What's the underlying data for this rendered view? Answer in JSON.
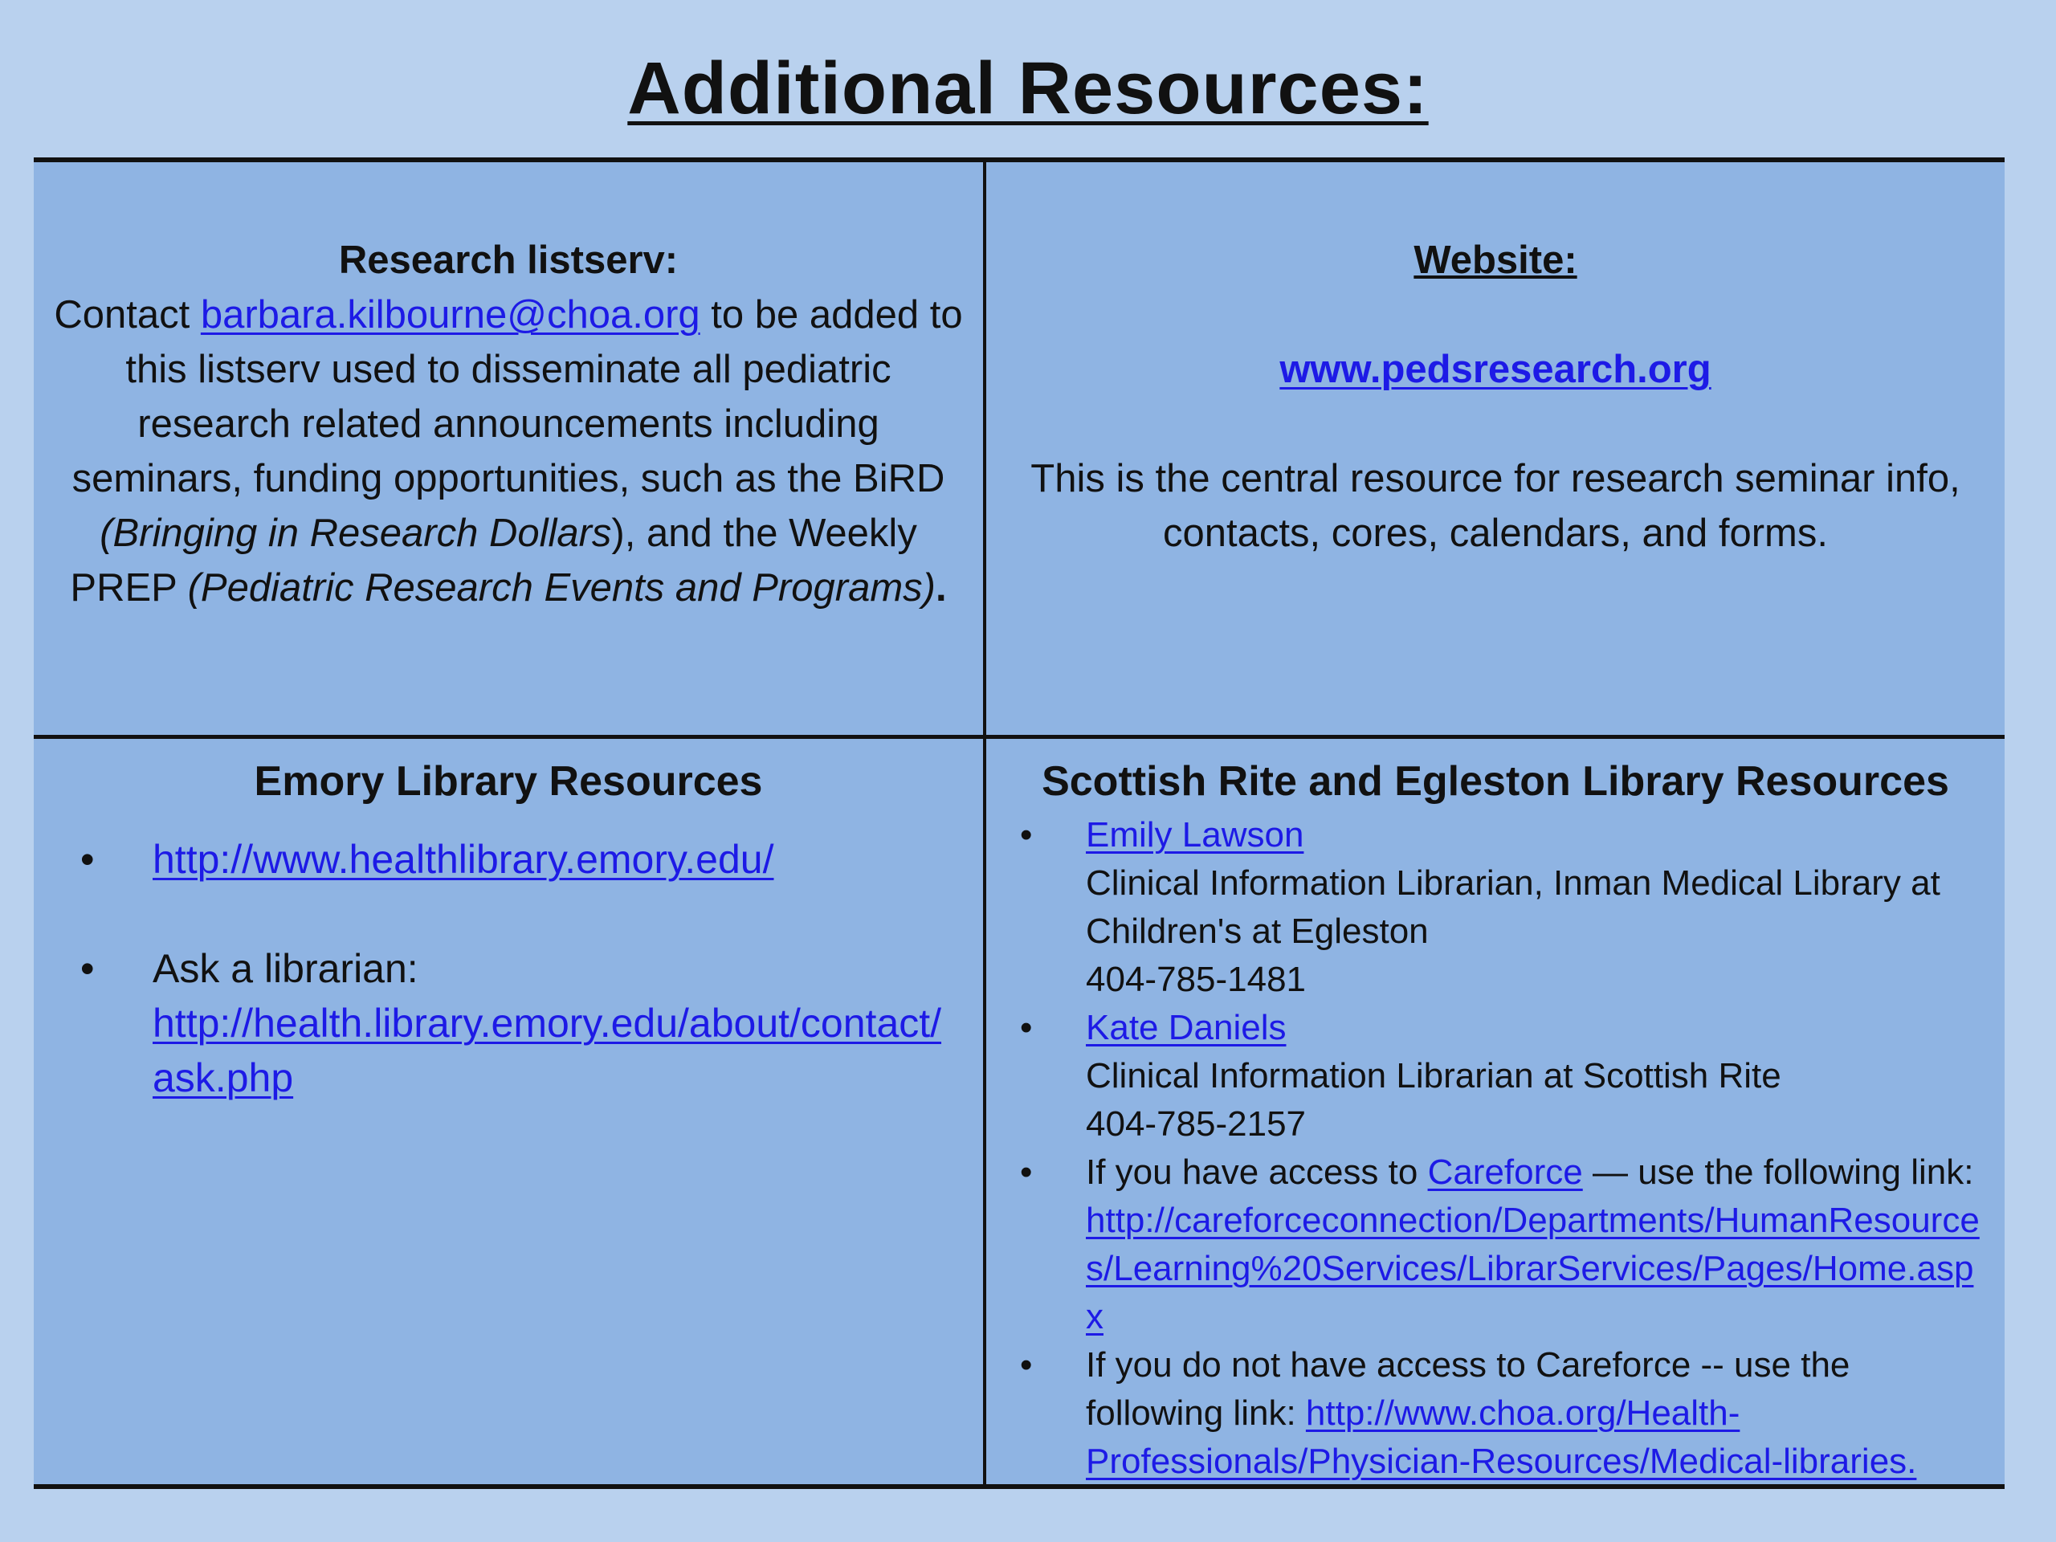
{
  "page": {
    "title": "Additional Resources:"
  },
  "listserv": {
    "heading": "Research listserv:",
    "contact_prefix": "Contact ",
    "email": "barbara.kilbourne@choa.org",
    "text_1": " to be added to this listserv used to disseminate all pediatric research related announcements including seminars, funding opportunities, such as the  BiRD ",
    "bird_full": "(Bringing in Research Dollars",
    "text_2": "), and the Weekly PREP ",
    "prep_full": "(Pediatric Research  Events and Programs)",
    "text_end": "."
  },
  "website": {
    "heading": "Website:",
    "url": "www.pedsresearch.org",
    "description": "This is the central resource for research seminar info, contacts, cores, calendars, and forms."
  },
  "emory": {
    "heading": "Emory Library Resources",
    "items": [
      {
        "link": "http://www.healthlibrary.emory.edu/"
      },
      {
        "label": "Ask a librarian:",
        "link": "http://health.library.emory.edu/about/contact/ask.php"
      }
    ]
  },
  "scottish": {
    "heading": "Scottish Rite and Egleston Library Resources",
    "items": [
      {
        "name": "Emily Lawson",
        "title": "Clinical Information Librarian, Inman Medical Library at Children's at Egleston",
        "phone": "404-785-1481"
      },
      {
        "name": "Kate Daniels",
        "title": "Clinical Information Librarian at Scottish Rite",
        "phone": "404-785-2157"
      },
      {
        "prefix": "If you have access to ",
        "careforce": "Careforce",
        "suffix": " — use the following link:",
        "link": "http://careforceconnection/Departments/HumanResources/Learning%20Services/LibrarServices/Pages/Home.aspx"
      },
      {
        "prefix": "If you do not have access to Careforce  -- use the following link: ",
        "link": "http://www.choa.org/Health-Professionals/Physician-Resources/Medical-libraries."
      }
    ]
  },
  "colors": {
    "page_background": "#b9d1ee",
    "cell_background": "#8fb4e3",
    "link": "#1d1ae6",
    "border": "#111111"
  }
}
